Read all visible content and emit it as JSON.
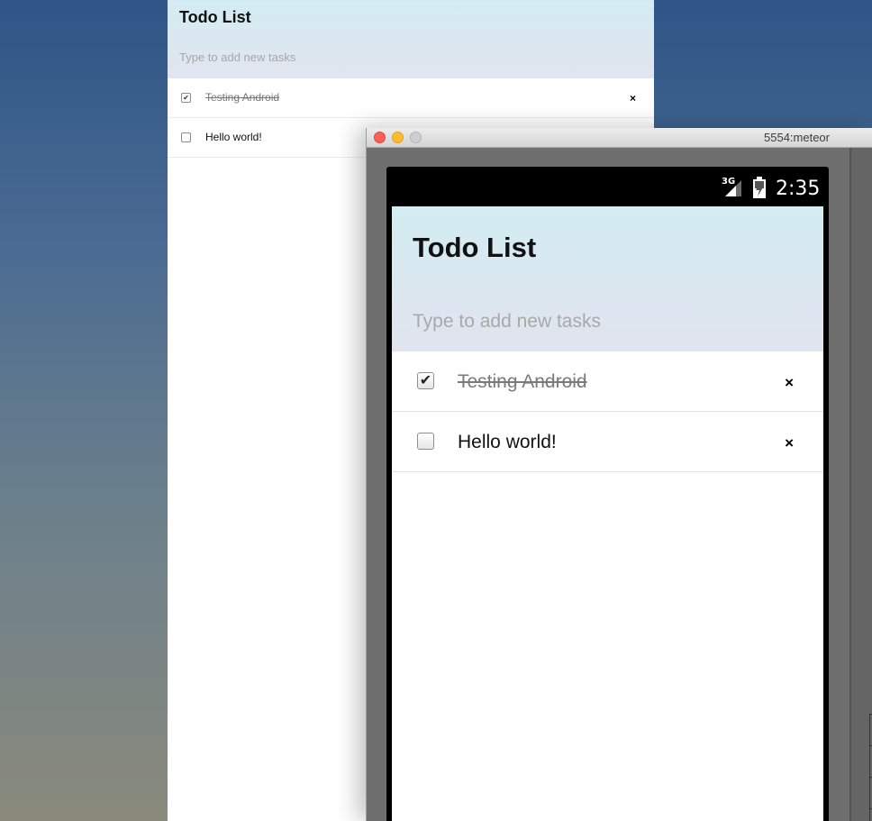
{
  "browser": {
    "title": "Todo List",
    "input_placeholder": "Type to add new tasks",
    "tasks": [
      {
        "text": "Testing Android",
        "checked": true,
        "check_mark": "✔",
        "delete_label": "×"
      },
      {
        "text": "Hello world!",
        "checked": false,
        "check_mark": "",
        "delete_label": ""
      }
    ]
  },
  "emulator": {
    "window_title": "5554:meteor",
    "statusbar": {
      "network": "3G",
      "time": "2:35"
    },
    "app": {
      "title": "Todo List",
      "input_placeholder": "Type to add new tasks",
      "tasks": [
        {
          "text": "Testing Android",
          "checked": true,
          "check_mark": "✔",
          "delete_label": "×"
        },
        {
          "text": "Hello world!",
          "checked": false,
          "check_mark": "",
          "delete_label": "×"
        }
      ]
    }
  },
  "colors": {
    "header_top": "#d3ecf3",
    "header_bottom": "#e1e4ee",
    "close_button": "#fc5f57",
    "minimize_button": "#fdbc2e",
    "zoom_button": "#cfcfcf"
  }
}
